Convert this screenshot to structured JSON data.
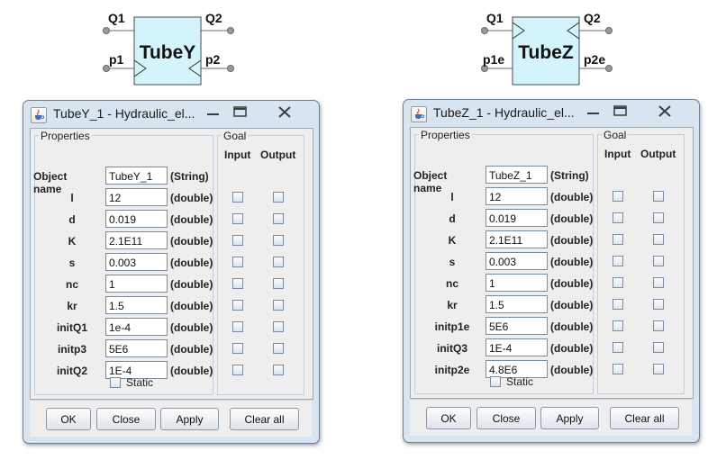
{
  "block_y": {
    "name": "TubeY",
    "ports": {
      "q1": "Q1",
      "q2": "Q2",
      "p1": "p1",
      "p2": "p2"
    }
  },
  "block_z": {
    "name": "TubeZ",
    "ports": {
      "q1": "Q1",
      "q2": "Q2",
      "p1": "p1e",
      "p2": "p2e"
    }
  },
  "dialog_y": {
    "title": "TubeY_1 - Hydraulic_el...",
    "properties_label": "Properties",
    "goal_label": "Goal",
    "input_header": "Input",
    "output_header": "Output",
    "static_label": "Static",
    "rows": [
      {
        "label": "Object name",
        "value": "TubeY_1",
        "type": "(String)"
      },
      {
        "label": "l",
        "value": "12",
        "type": "(double)"
      },
      {
        "label": "d",
        "value": "0.019",
        "type": "(double)"
      },
      {
        "label": "K",
        "value": "2.1E11",
        "type": "(double)"
      },
      {
        "label": "s",
        "value": "0.003",
        "type": "(double)"
      },
      {
        "label": "nc",
        "value": "1",
        "type": "(double)"
      },
      {
        "label": "kr",
        "value": "1.5",
        "type": "(double)"
      },
      {
        "label": "initQ1",
        "value": "1e-4",
        "type": "(double)"
      },
      {
        "label": "initp3",
        "value": "5E6",
        "type": "(double)"
      },
      {
        "label": "initQ2",
        "value": "1E-4",
        "type": "(double)"
      }
    ],
    "buttons": {
      "ok": "OK",
      "close": "Close",
      "apply": "Apply",
      "clear": "Clear all"
    }
  },
  "dialog_z": {
    "title": "TubeZ_1 - Hydraulic_el...",
    "properties_label": "Properties",
    "goal_label": "Goal",
    "input_header": "Input",
    "output_header": "Output",
    "static_label": "Static",
    "rows": [
      {
        "label": "Object name",
        "value": "TubeZ_1",
        "type": "(String)"
      },
      {
        "label": "l",
        "value": "12",
        "type": "(double)"
      },
      {
        "label": "d",
        "value": "0.019",
        "type": "(double)"
      },
      {
        "label": "K",
        "value": "2.1E11",
        "type": "(double)"
      },
      {
        "label": "s",
        "value": "0.003",
        "type": "(double)"
      },
      {
        "label": "nc",
        "value": "1",
        "type": "(double)"
      },
      {
        "label": "kr",
        "value": "1.5",
        "type": "(double)"
      },
      {
        "label": "initp1e",
        "value": "5E6",
        "type": "(double)"
      },
      {
        "label": "initQ3",
        "value": "1E-4",
        "type": "(double)"
      },
      {
        "label": "initp2e",
        "value": "4.8E6",
        "type": "(double)"
      }
    ],
    "buttons": {
      "ok": "OK",
      "close": "Close",
      "apply": "Apply",
      "clear": "Clear all"
    }
  },
  "colors": {
    "block_fill": "#d2f4fa",
    "dialog_frame": "#d9e4f1",
    "panel": "#eeeeee"
  },
  "icons": [
    "java-cup-icon",
    "minimize-icon",
    "maximize-icon",
    "close-icon"
  ]
}
